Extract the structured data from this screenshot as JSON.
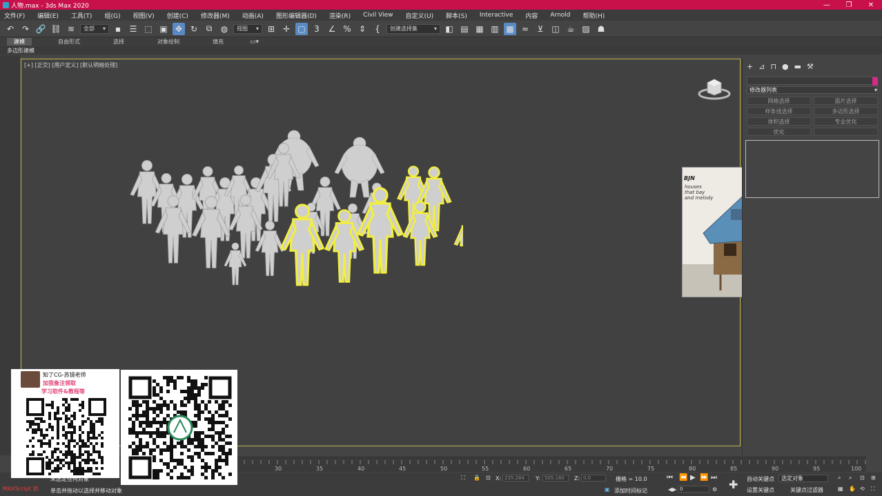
{
  "window": {
    "title": "人物.max - 3ds Max 2020",
    "controls": [
      "—",
      "❐",
      "✕"
    ]
  },
  "menu": [
    "文件(F)",
    "编辑(E)",
    "工具(T)",
    "组(G)",
    "视图(V)",
    "创建(C)",
    "修改器(M)",
    "动画(A)",
    "图形编辑器(D)",
    "渲染(R)",
    "Civil View",
    "自定义(U)",
    "脚本(S)",
    "Interactive",
    "内容",
    "Arnold",
    "帮助(H)"
  ],
  "toolbar": {
    "filter_dropdown": "全部",
    "coord_dropdown": "视图",
    "selection_set": "创建选择集"
  },
  "ribbon": {
    "tabs": [
      "建模",
      "自由形式",
      "选择",
      "对象绘制",
      "填充"
    ],
    "sub_label": "多边形建模"
  },
  "viewport": {
    "label": "[+] [正交] [用户定义] [默认明暗处理]"
  },
  "command_panel": {
    "modifier_list": "修改器列表",
    "buttons": [
      "网格选择",
      "面片选择",
      "样条线选择",
      "多边形选择",
      "体积选择",
      "专业优化",
      "优化",
      ""
    ]
  },
  "overlay_image": {
    "label": "BJN",
    "caption": "houses\nthat bay\nand melody"
  },
  "timeline": {
    "ticks": [
      "30",
      "35",
      "40",
      "45",
      "50",
      "55",
      "60",
      "65",
      "70",
      "75",
      "80",
      "85",
      "90",
      "95",
      "100"
    ]
  },
  "status": {
    "selected": "未选定任何对象",
    "hint": "单击并拖动以选择并移动对象",
    "script": "MAXScript 侦",
    "x_label": "X:",
    "x_value": "235.284",
    "y_label": "Y:",
    "y_value": "505.180",
    "z_label": "Z:",
    "z_value": "0.0",
    "grid": "栅格 = 10.0",
    "add_time_tag": "添加时间标记",
    "auto_key": "自动关键点",
    "set_key": "设置关键点",
    "selected_obj": "选定对象",
    "key_filter": "关键点过滤器",
    "frame": "0"
  },
  "promo": {
    "name": "知了CG-苏镜老师",
    "line1": "加我备注领取",
    "line2": "学习软件&教程等"
  }
}
